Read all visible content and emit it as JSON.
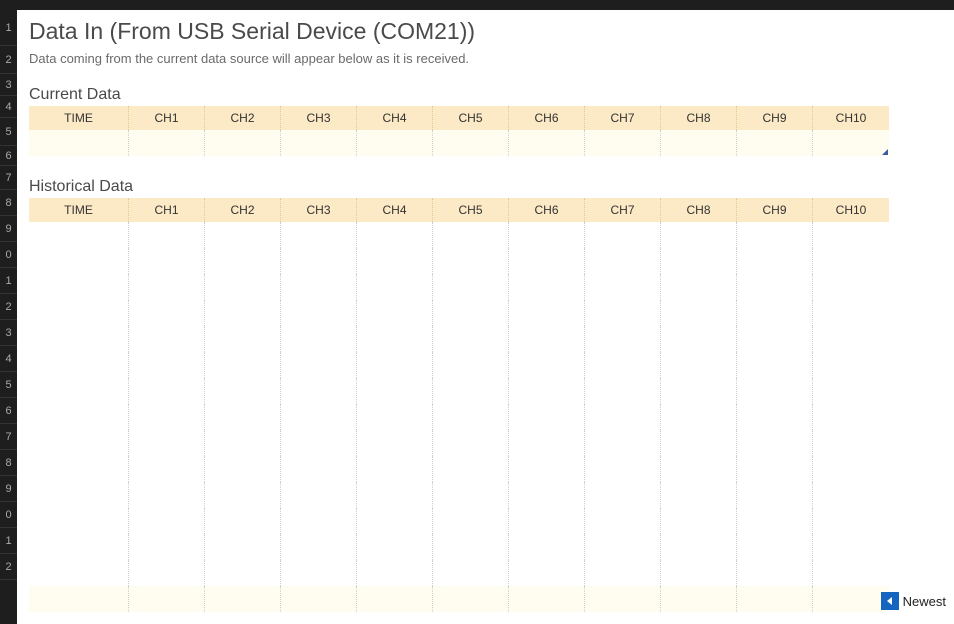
{
  "rowNumbers": [
    "1",
    "2",
    "3",
    "4",
    "5",
    "6",
    "7",
    "8",
    "9",
    "0",
    "1",
    "2",
    "3",
    "4",
    "5",
    "6",
    "7",
    "8",
    "9",
    "0",
    "1",
    "2"
  ],
  "page": {
    "title": "Data In (From USB Serial Device (COM21))",
    "subtitle": "Data coming from the current data source will appear below as it is received."
  },
  "currentData": {
    "heading": "Current Data",
    "columns": [
      "TIME",
      "CH1",
      "CH2",
      "CH3",
      "CH4",
      "CH5",
      "CH6",
      "CH7",
      "CH8",
      "CH9",
      "CH10"
    ],
    "rows": [
      [
        "",
        "",
        "",
        "",
        "",
        "",
        "",
        "",
        "",
        "",
        ""
      ]
    ]
  },
  "historicalData": {
    "heading": "Historical Data",
    "columns": [
      "TIME",
      "CH1",
      "CH2",
      "CH3",
      "CH4",
      "CH5",
      "CH6",
      "CH7",
      "CH8",
      "CH9",
      "CH10"
    ],
    "rowCount": 15
  },
  "newestButton": {
    "label": "Newest",
    "iconName": "arrow-left-icon"
  }
}
